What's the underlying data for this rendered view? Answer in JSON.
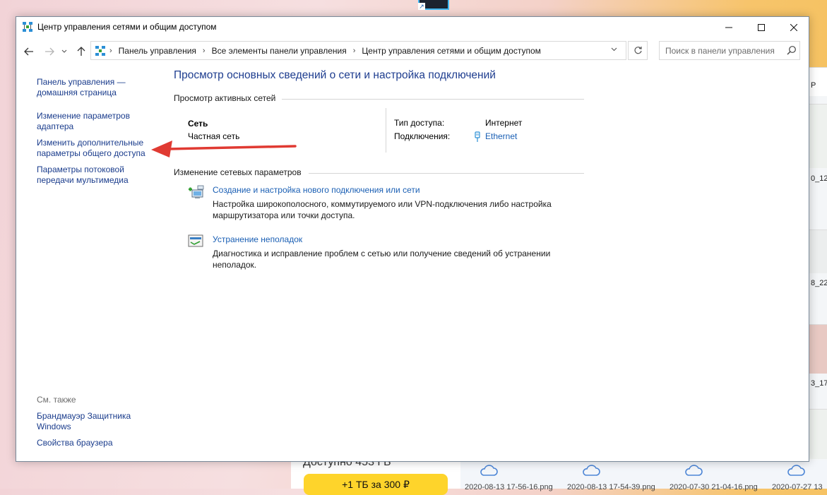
{
  "window": {
    "title": "Центр управления сетями и общим доступом",
    "controls": {
      "minimize": "—",
      "maximize": "☐",
      "close": "✕"
    }
  },
  "nav": {
    "breadcrumbs": [
      "Панель управления",
      "Все элементы панели управления",
      "Центр управления сетями и общим доступом"
    ],
    "search_placeholder": "Поиск в панели управления"
  },
  "left_pane": {
    "links": [
      "Панель управления — домашняя страница",
      "Изменение параметров адаптера",
      "Изменить дополнительные параметры общего доступа",
      "Параметры потоковой передачи мультимедиа"
    ],
    "see_also_label": "См. также",
    "see_also": [
      "Брандмауэр Защитника Windows",
      "Свойства браузера"
    ]
  },
  "main": {
    "title": "Просмотр основных сведений о сети и настройка подключений",
    "active_networks_label": "Просмотр активных сетей",
    "network": {
      "name": "Сеть",
      "type": "Частная сеть",
      "access_type_label": "Тип доступа:",
      "access_type_value": "Интернет",
      "connections_label": "Подключения:",
      "connection_link": "Ethernet"
    },
    "change_settings_label": "Изменение сетевых параметров",
    "tasks": [
      {
        "link": "Создание и настройка нового подключения или сети",
        "desc_lines": [
          "Настройка широкополосного, коммутируемого или VPN-подключения либо настройка",
          "маршрутизатора или точки доступа."
        ]
      },
      {
        "link": "Устранение неполадок",
        "desc_lines": [
          "Диагностика и исправление проблем с сетью или получение сведений об устранении",
          "неполадок."
        ]
      }
    ]
  },
  "background": {
    "right_fragments": [
      "Р",
      "0_12",
      "8_22",
      "3_17"
    ],
    "bottom_panel_text": "Доступно 453 ГБ",
    "yellow_button": "+1 ТБ за 300 ₽",
    "files": [
      "2020-08-13 17-56-16.png",
      "2020-08-13 17-54-39.png",
      "2020-07-30 21-04-16.png",
      "2020-07-27 13"
    ]
  },
  "colors": {
    "link": "#1a5fb4",
    "left_link": "#1a3c8c",
    "title": "#1e3d8f",
    "annotation_arrow": "#e03a32"
  }
}
